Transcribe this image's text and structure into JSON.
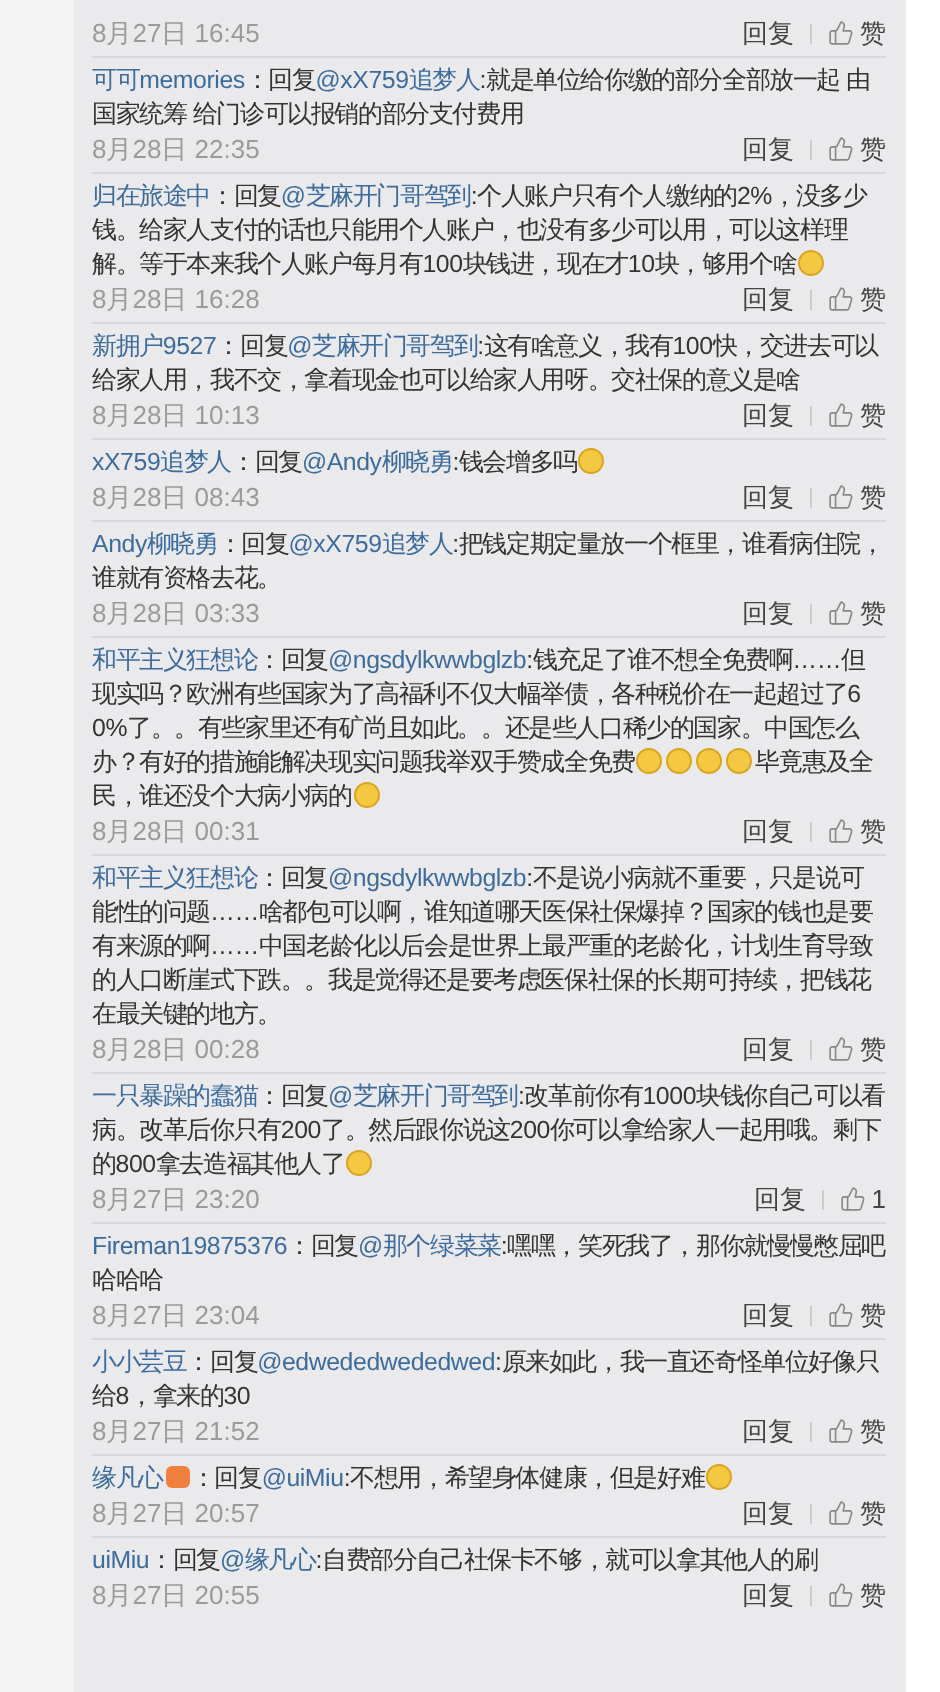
{
  "comments": [
    {
      "time": "8月27日 16:45",
      "reply_label": "回复",
      "like_label": "赞"
    },
    {
      "user": "可可memories",
      "reply_prefix": "：回复",
      "mention": "@xX759追梦人",
      "body": [
        {
          "kind": "text",
          "text": ":就是单位给你缴的部分全部放一起 由国家统筹 给门诊可以报销的部分支付费用"
        }
      ],
      "time": "8月28日 22:35",
      "reply_label": "回复",
      "like_label": "赞"
    },
    {
      "user": "归在旅途中",
      "reply_prefix": "：回复",
      "mention": "@芝麻开门哥驾到",
      "body": [
        {
          "kind": "text",
          "text": ":个人账户只有个人缴纳的2%，没多少钱。给家人支付的话也只能用个人账户，也没有多少可以用，可以这样理解。等于本来我个人账户每月有100块钱进，现在才10块，够用个啥"
        },
        {
          "kind": "emoji"
        }
      ],
      "time": "8月28日 16:28",
      "reply_label": "回复",
      "like_label": "赞"
    },
    {
      "user": "新拥户9527",
      "reply_prefix": "：回复",
      "mention": "@芝麻开门哥驾到",
      "body": [
        {
          "kind": "text",
          "text": ":这有啥意义，我有100快，交进去可以给家人用，我不交，拿着现金也可以给家人用呀。交社保的意义是啥"
        }
      ],
      "time": "8月28日 10:13",
      "reply_label": "回复",
      "like_label": "赞"
    },
    {
      "user": "xX759追梦人",
      "reply_prefix": "：回复",
      "mention": "@Andy柳晓勇",
      "body": [
        {
          "kind": "text",
          "text": ":钱会增多吗"
        },
        {
          "kind": "emoji"
        }
      ],
      "time": "8月28日 08:43",
      "reply_label": "回复",
      "like_label": "赞"
    },
    {
      "user": "Andy柳晓勇",
      "reply_prefix": "：回复",
      "mention": "@xX759追梦人",
      "body": [
        {
          "kind": "text",
          "text": ":把钱定期定量放一个框里，谁看病住院，谁就有资格去花。"
        }
      ],
      "time": "8月28日 03:33",
      "reply_label": "回复",
      "like_label": "赞"
    },
    {
      "user": "和平主义狂想论",
      "reply_prefix": "：回复",
      "mention": "@ngsdylkwwbglzb",
      "body": [
        {
          "kind": "text",
          "text": ":钱充足了谁不想全免费啊……但现实吗？欧洲有些国家为了高福利不仅大幅举债，各种税价在一起超过了60%了。。有些家里还有矿尚且如此。。还是些人口稀少的国家。中国怎么办？有好的措施能解决现实问题我举双手赞成全免费"
        },
        {
          "kind": "emoji"
        },
        {
          "kind": "emoji"
        },
        {
          "kind": "emoji"
        },
        {
          "kind": "emoji"
        },
        {
          "kind": "text",
          "text": "毕竟惠及全民，谁还没个大病小病的"
        },
        {
          "kind": "emoji"
        }
      ],
      "time": "8月28日 00:31",
      "reply_label": "回复",
      "like_label": "赞"
    },
    {
      "user": "和平主义狂想论",
      "reply_prefix": "：回复",
      "mention": "@ngsdylkwwbglzb",
      "body": [
        {
          "kind": "text",
          "text": ":不是说小病就不重要，只是说可能性的问题……啥都包可以啊，谁知道哪天医保社保爆掉？国家的钱也是要有来源的啊……中国老龄化以后会是世界上最严重的老龄化，计划生育导致的人口断崖式下跌。。我是觉得还是要考虑医保社保的长期可持续，把钱花在最关键的地方。"
        }
      ],
      "time": "8月28日 00:28",
      "reply_label": "回复",
      "like_label": "赞"
    },
    {
      "user": "一只暴躁的蠢猫",
      "reply_prefix": "：回复",
      "mention": "@芝麻开门哥驾到",
      "body": [
        {
          "kind": "text",
          "text": ":改革前你有1000块钱你自己可以看病。改革后你只有200了。然后跟你说这200你可以拿给家人一起用哦。剩下的800拿去造福其他人了"
        },
        {
          "kind": "emoji"
        }
      ],
      "time": "8月27日 23:20",
      "reply_label": "回复",
      "like_label": "1"
    },
    {
      "user": "Fireman19875376",
      "reply_prefix": "：回复",
      "mention": "@那个绿菜菜",
      "body": [
        {
          "kind": "text",
          "text": ":嘿嘿，笑死我了，那你就慢慢憋屈吧哈哈哈"
        }
      ],
      "time": "8月27日 23:04",
      "reply_label": "回复",
      "like_label": "赞"
    },
    {
      "user": "小小芸豆",
      "reply_prefix": "：回复",
      "mention": "@edwededwededwed",
      "body": [
        {
          "kind": "text",
          "text": ":原来如此，我一直还奇怪单位好像只给8，拿来的30"
        }
      ],
      "time": "8月27日 21:52",
      "reply_label": "回复",
      "like_label": "赞"
    },
    {
      "user": "缘凡心",
      "user_badge": true,
      "reply_prefix": "：回复",
      "mention": "@uiMiu",
      "body": [
        {
          "kind": "text",
          "text": ":不想用，希望身体健康，但是好难"
        },
        {
          "kind": "emoji"
        }
      ],
      "time": "8月27日 20:57",
      "reply_label": "回复",
      "like_label": "赞"
    },
    {
      "user": "uiMiu",
      "reply_prefix": "：回复",
      "mention": "@缘凡心",
      "body": [
        {
          "kind": "text",
          "text": ":自费部分自己社保卡不够，就可以拿其他人的刷"
        }
      ],
      "time": "8月27日 20:55",
      "reply_label": "回复",
      "like_label": "赞"
    }
  ]
}
